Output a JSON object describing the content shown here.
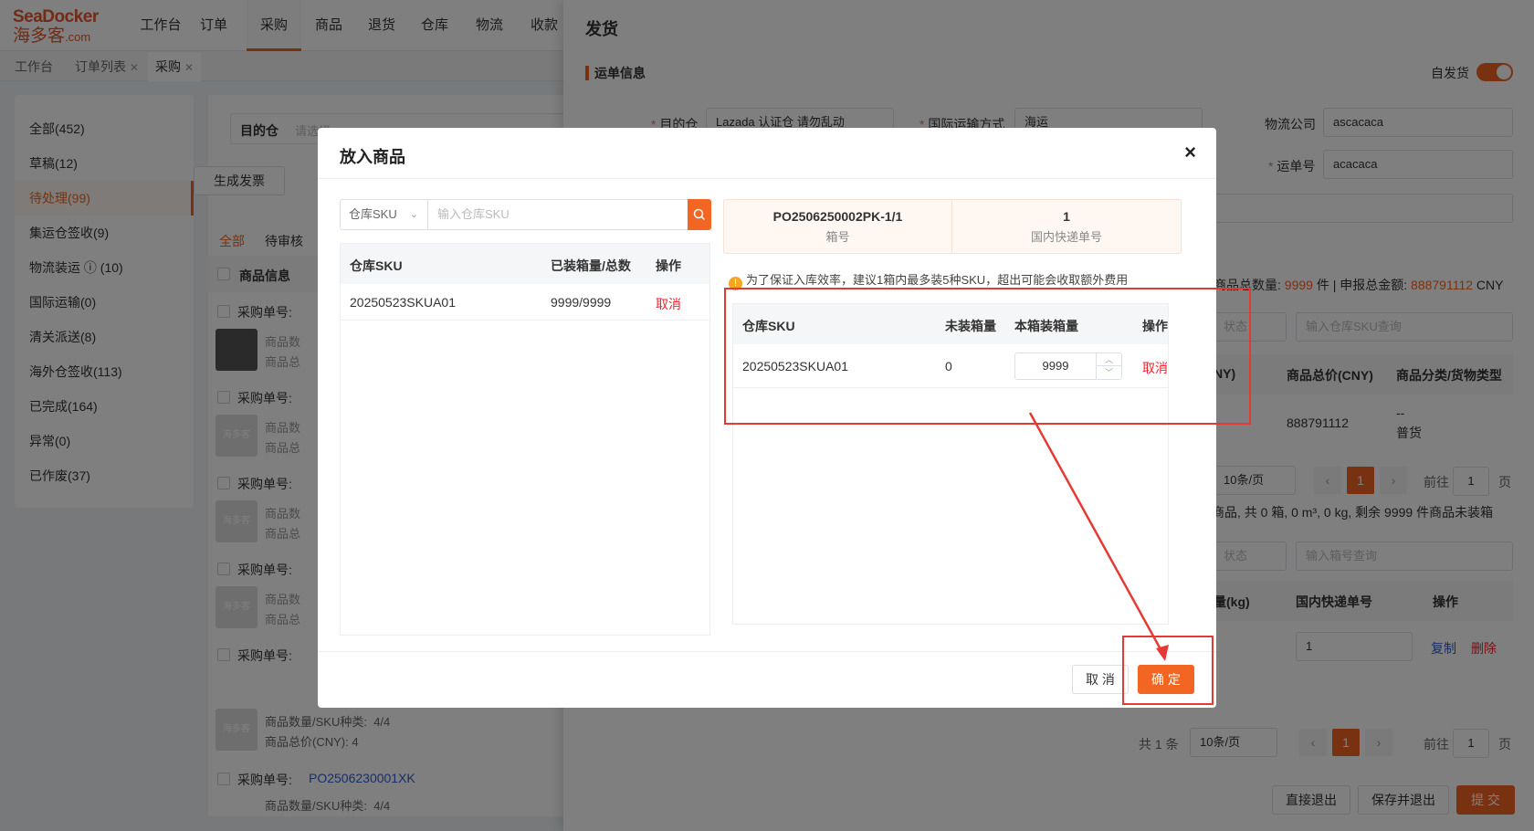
{
  "brand": {
    "line1": "SeaDocker",
    "line2": "海多客",
    "domain": ".com",
    "color": "#e4572e"
  },
  "accent": "#f26522",
  "nav": [
    "工作台",
    "订单",
    "采购",
    "商品",
    "退货",
    "仓库",
    "物流",
    "收款"
  ],
  "nav_active": "采购",
  "tabs": [
    {
      "label": "工作台",
      "closable": false
    },
    {
      "label": "订单列表",
      "closable": true
    },
    {
      "label": "采购",
      "closable": true,
      "active": true
    }
  ],
  "sidebar": {
    "items": [
      {
        "label": "全部(452)"
      },
      {
        "label": "草稿(12)"
      },
      {
        "label": "待处理(99)",
        "active": true
      },
      {
        "label": "集运仓签收(9)"
      },
      {
        "label": "物流装运 ⓘ (10)"
      },
      {
        "label": "国际运输(0)"
      },
      {
        "label": "清关派送(8)"
      },
      {
        "label": "海外仓签收(113)"
      },
      {
        "label": "已完成(164)"
      },
      {
        "label": "异常(0)"
      },
      {
        "label": "已作废(37)"
      }
    ]
  },
  "middle": {
    "dest_label": "目的仓",
    "dest_placeholder": "请选择",
    "gen_invoice": "生成发票",
    "filter_tabs": [
      "全部",
      "待审核"
    ],
    "col_product": "商品信息",
    "po_label": "采购单号:",
    "qty_label": "商品数量/SKU种类:",
    "qty_value": "4/4",
    "total_label": "商品总价(CNY):",
    "total_value": "4",
    "po_number": "PO2506230001XK",
    "thumb_text": "海多客",
    "trunc1": "商品数",
    "trunc2": "商品总"
  },
  "right": {
    "title": "发货",
    "section": "运单信息",
    "self_ship": "自发货",
    "dest_label": "目的仓",
    "dest_value": "Lazada 认证仓 请勿乱动",
    "intl_label": "国际运输方式",
    "intl_value": "海运",
    "carrier_label": "物流公司",
    "carrier_value": "ascacaca",
    "waybill_label": "运单号",
    "waybill_value": "acacaca",
    "summary_qty_label": "商品总数量:",
    "summary_qty": "9999",
    "summary_qty_unit": "件",
    "summary_amt_label": "申报总金额:",
    "summary_amt": "888791112",
    "summary_amt_unit": "CNY",
    "sku_search_placeholder": "输入仓库SKU查询",
    "status_ph": "状态",
    "col_ny": "NY)",
    "col_total": "商品总价(CNY)",
    "col_category": "商品分类/货物类型",
    "row_total": "888791112",
    "row_cat1": "--",
    "row_cat2": "普货",
    "page_size1": "10条/页",
    "page_current": "1",
    "goto_label": "前往",
    "goto_value": "1",
    "page_unit": "页",
    "pack_summary": "商品, 共 0 箱, 0 m³, 0 kg, 剩余 9999 件商品未装箱",
    "box_search_placeholder": "输入箱号查询",
    "col_weight": "量(kg)",
    "col_express": "国内快递单号",
    "col_op": "操作",
    "express_value": "1",
    "copy": "复制",
    "delete": "删除",
    "total_count": "共 1 条",
    "page_size2": "10条/页",
    "btn_exit": "直接退出",
    "btn_save": "保存并退出",
    "btn_submit": "提 交"
  },
  "modal": {
    "title": "放入商品",
    "close": "×",
    "search_type": "仓库SKU",
    "search_placeholder": "输入仓库SKU",
    "left_table": {
      "headers": [
        "仓库SKU",
        "已装箱量/总数",
        "操作"
      ],
      "rows": [
        {
          "sku": "20250523SKUA01",
          "qty": "9999/9999",
          "op": "取消"
        }
      ]
    },
    "box_no": "PO2506250002PK-1/1",
    "box_no_label": "箱号",
    "express_no": "1",
    "express_label": "国内快递单号",
    "tip": "为了保证入库效率，建议1箱内最多装5种SKU，超出可能会收取额外费用",
    "right_table": {
      "headers": [
        "仓库SKU",
        "未装箱量",
        "本箱装箱量",
        "操作"
      ],
      "rows": [
        {
          "sku": "20250523SKUA01",
          "unpacked": "0",
          "qty": "9999",
          "op": "取消"
        }
      ]
    },
    "cancel": "取 消",
    "confirm": "确 定"
  }
}
